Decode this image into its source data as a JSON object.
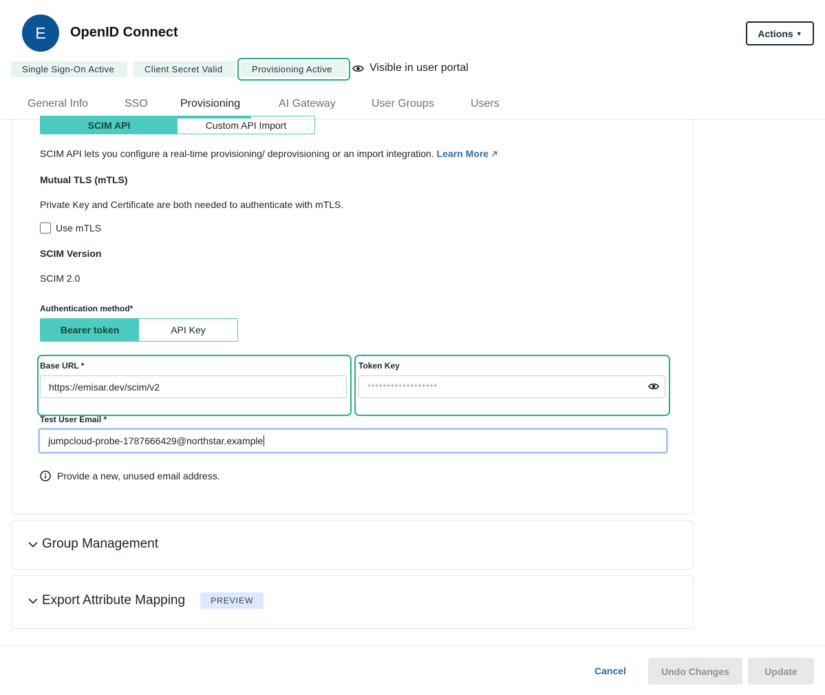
{
  "header": {
    "avatar_letter": "E",
    "title": "OpenID Connect",
    "actions_label": "Actions",
    "badges": [
      "Single Sign-On Active",
      "Client Secret Valid",
      "Provisioning Active"
    ],
    "visible_label": "Visible in user portal"
  },
  "tabs": [
    "General Info",
    "SSO",
    "Provisioning",
    "AI Gateway",
    "User Groups",
    "Users"
  ],
  "active_tab": "Provisioning",
  "provisioning": {
    "type_options": [
      "SCIM API",
      "Custom API Import"
    ],
    "selected_type": "SCIM API",
    "description": "SCIM API lets you configure a real-time provisioning/ deprovisioning or an import integration.",
    "learn_more": "Learn More",
    "mtls_heading": "Mutual TLS (mTLS)",
    "mtls_description": "Private Key and Certificate are both needed to authenticate with mTLS.",
    "use_mtls_label": "Use mTLS",
    "use_mtls_checked": false,
    "scim_version_heading": "SCIM Version",
    "scim_version_value": "SCIM 2.0",
    "auth_method_label": "Authentication method*",
    "auth_options": [
      "Bearer token",
      "API Key"
    ],
    "selected_auth": "Bearer token",
    "base_url_label": "Base URL *",
    "base_url_value": "https://emisar.dev/scim/v2",
    "token_key_label": "Token Key",
    "token_key_placeholder": "******************",
    "test_email_label": "Test User Email *",
    "test_email_value": "jumpcloud-probe-1787666429@northstar.example",
    "email_hint": "Provide a new, unused email address."
  },
  "accordions": {
    "group_management": "Group Management",
    "export_mapping": "Export Attribute Mapping",
    "preview_badge": "PREVIEW"
  },
  "footer": {
    "cancel": "Cancel",
    "undo": "Undo Changes",
    "update": "Update"
  },
  "colors": {
    "accent": "#27ad8c",
    "segment_active": "#4ccbc0",
    "avatar": "#0b5394",
    "link": "#2f6ea6"
  }
}
